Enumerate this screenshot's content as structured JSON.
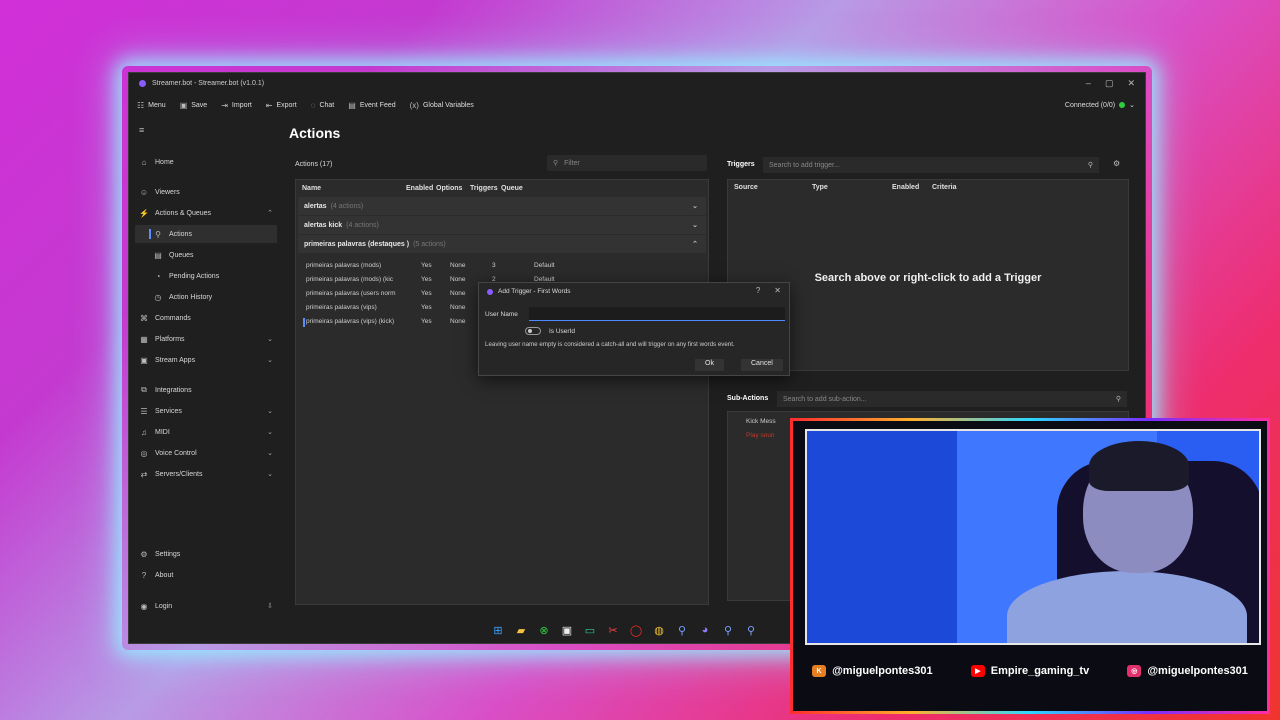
{
  "window": {
    "title": "Streamer.bot - Streamer.bot (v1.0.1)",
    "minimize": "–",
    "maximize": "▢",
    "close": "✕"
  },
  "menubar": {
    "items": [
      {
        "icon": "menu-icon",
        "glyph": "☷",
        "label": "Menu"
      },
      {
        "icon": "save-icon",
        "glyph": "▣",
        "label": "Save"
      },
      {
        "icon": "import-icon",
        "glyph": "⇥",
        "label": "Import"
      },
      {
        "icon": "export-icon",
        "glyph": "⇤",
        "label": "Export"
      },
      {
        "icon": "chat-icon",
        "glyph": "◌",
        "label": "Chat"
      },
      {
        "icon": "event-feed-icon",
        "glyph": "▤",
        "label": "Event Feed"
      },
      {
        "icon": "global-variables-icon",
        "glyph": "(x)",
        "label": "Global Variables"
      }
    ],
    "connection": "Connected (0/0)",
    "connection_color": "#2ecc40"
  },
  "sidebar": {
    "hamburger": "≡",
    "items": [
      {
        "label": "Home",
        "glyph": "⌂"
      },
      {
        "label": "Viewers",
        "glyph": "☺"
      },
      {
        "label": "Actions & Queues",
        "glyph": "⚡",
        "chevron": "⌃"
      },
      {
        "label": "Actions",
        "glyph": "⚲"
      },
      {
        "label": "Queues",
        "glyph": "▤"
      },
      {
        "label": "Pending Actions",
        "glyph": "◔"
      },
      {
        "label": "Action History",
        "glyph": "◷"
      },
      {
        "label": "Commands",
        "glyph": "⌘"
      },
      {
        "label": "Platforms",
        "glyph": "▦",
        "chevron": "⌄"
      },
      {
        "label": "Stream Apps",
        "glyph": "▣",
        "chevron": "⌄"
      },
      {
        "label": "Integrations",
        "glyph": "⧉"
      },
      {
        "label": "Services",
        "glyph": "☰",
        "chevron": "⌄"
      },
      {
        "label": "MIDI",
        "glyph": "♫",
        "chevron": "⌄"
      },
      {
        "label": "Voice Control",
        "glyph": "◎",
        "chevron": "⌄"
      },
      {
        "label": "Servers/Clients",
        "glyph": "⇄",
        "chevron": "⌄"
      },
      {
        "label": "Settings",
        "glyph": "⚙"
      },
      {
        "label": "About",
        "glyph": "?"
      },
      {
        "label": "Login",
        "glyph": "◉",
        "chevron": "⇩"
      }
    ]
  },
  "main": {
    "title": "Actions",
    "actions_header": "Actions (17)",
    "filter_placeholder": "Filter",
    "columns": [
      "Name",
      "Enabled",
      "Options",
      "Triggers",
      "Queue"
    ],
    "groups": [
      {
        "name": "alertas",
        "count": "(4 actions)",
        "chevron": "⌄"
      },
      {
        "name": "alertas kick",
        "count": "(4 actions)",
        "chevron": "⌄"
      },
      {
        "name": "primeiras palavras (destaques )",
        "count": "(5 actions)",
        "chevron": "⌃"
      }
    ],
    "rows": [
      {
        "name": "primeiras palavras (mods)",
        "enabled": "Yes",
        "options": "None",
        "triggers": "3",
        "queue": "Default"
      },
      {
        "name": "primeiras palavras (mods) (kic",
        "enabled": "Yes",
        "options": "None",
        "triggers": "2",
        "queue": "Default"
      },
      {
        "name": "primeiras palavras (users norm",
        "enabled": "Yes",
        "options": "None",
        "triggers": "",
        "queue": ""
      },
      {
        "name": "primeiras palavras (vips)",
        "enabled": "Yes",
        "options": "None",
        "triggers": "",
        "queue": ""
      },
      {
        "name": "primeiras palavras (vips) (kick)",
        "enabled": "Yes",
        "options": "None",
        "triggers": "",
        "queue": ""
      }
    ]
  },
  "triggers": {
    "header": "Triggers",
    "search_placeholder": "Search to add trigger...",
    "columns": [
      "Source",
      "Type",
      "Enabled",
      "Criteria"
    ],
    "empty": "Search above or right-click to add a Trigger"
  },
  "subactions": {
    "header": "Sub-Actions",
    "search_placeholder": "Search to add sub-action...",
    "items": [
      "Kick Mess",
      "Play soun"
    ]
  },
  "dialog": {
    "title": "Add Trigger - First Words",
    "help": "?",
    "close": "✕",
    "user_name_label": "User Name",
    "user_name_value": "",
    "toggle_label": "Is UserId",
    "note": "Leaving user name empty is considered a catch-all and will trigger on any first words event.",
    "ok": "Ok",
    "cancel": "Cancel"
  },
  "taskbar": [
    {
      "icon": "windows-start-icon",
      "glyph": "⊞",
      "color": "#3aa0ff"
    },
    {
      "icon": "file-explorer-icon",
      "glyph": "▰",
      "color": "#f5c242"
    },
    {
      "icon": "xbox-icon",
      "glyph": "⊗",
      "color": "#2ecc40"
    },
    {
      "icon": "store-icon",
      "glyph": "▣",
      "color": "#eeeeee"
    },
    {
      "icon": "terminal-icon",
      "glyph": "▭",
      "color": "#2ecc9a"
    },
    {
      "icon": "capcut-icon",
      "glyph": "✂",
      "color": "#ff4444"
    },
    {
      "icon": "opera-icon",
      "glyph": "◯",
      "color": "#ff2a2a"
    },
    {
      "icon": "chrome-icon",
      "glyph": "◍",
      "color": "#f0c030"
    },
    {
      "icon": "streamerbot-icon",
      "glyph": "⚲",
      "color": "#7aa0ff"
    },
    {
      "icon": "discord-icon",
      "glyph": "◕",
      "color": "#8a7cff"
    },
    {
      "icon": "app-icon",
      "glyph": "⚲",
      "color": "#7aa0ff"
    },
    {
      "icon": "app-icon-2",
      "glyph": "⚲",
      "color": "#7aa0ff"
    }
  ],
  "overlay": {
    "socials": [
      {
        "icon": "kick-icon",
        "glyph": "K",
        "color": "#e67e22",
        "handle": "@miguelpontes301"
      },
      {
        "icon": "youtube-icon",
        "glyph": "▶",
        "color": "#ff0000",
        "handle": "Empire_gaming_tv"
      },
      {
        "icon": "instagram-icon",
        "glyph": "◎",
        "color": "#e1306c",
        "handle": "@miguelpontes301"
      }
    ]
  }
}
